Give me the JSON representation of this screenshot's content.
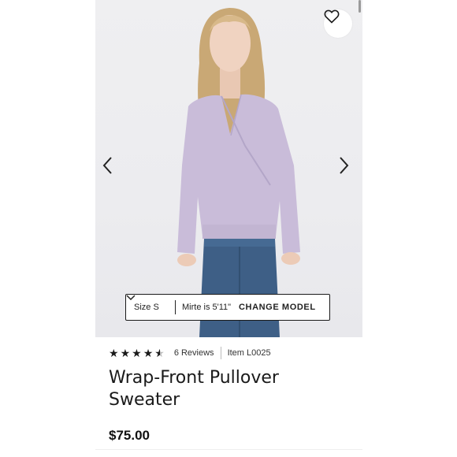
{
  "product": {
    "title": "Wrap-Front Pullover Sweater",
    "price": "$75.00",
    "rating": 4.5,
    "rating_max": 5,
    "reviews": "6 Reviews",
    "item": "Item L0025"
  },
  "model_bar": {
    "size": "Size S",
    "height": "Mirte is 5'11\"",
    "change_label": "CHANGE MODEL"
  },
  "icons": {
    "wishlist": "heart-icon",
    "prev": "chevron-left-icon",
    "next": "chevron-right-icon",
    "dropdown": "chevron-down-icon"
  },
  "colors": {
    "sweater": "#c9bcd9",
    "jeans": "#3e5f86",
    "text": "#1a1a1a"
  }
}
